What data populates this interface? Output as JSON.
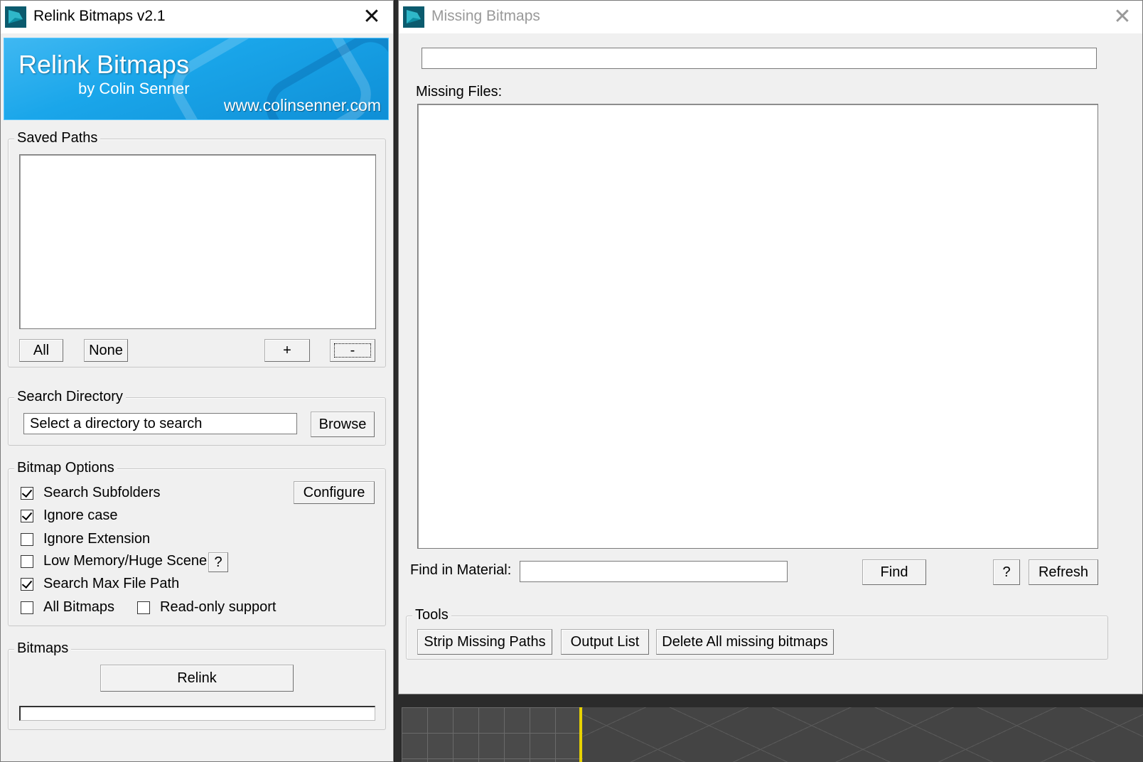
{
  "relink_window": {
    "title": "Relink Bitmaps v2.1",
    "banner": {
      "title": "Relink Bitmaps",
      "author": "by Colin Senner",
      "url": "www.colinsenner.com"
    },
    "saved_paths": {
      "label": "Saved Paths",
      "buttons": {
        "all": "All",
        "none": "None",
        "add": "+",
        "remove": "-"
      }
    },
    "search_directory": {
      "label": "Search Directory",
      "value": "Select a directory to search",
      "browse": "Browse"
    },
    "bitmap_options": {
      "label": "Bitmap Options",
      "configure": "Configure",
      "help": "?",
      "options": [
        {
          "label": "Search Subfolders",
          "checked": true
        },
        {
          "label": "Ignore case",
          "checked": true
        },
        {
          "label": "Ignore Extension",
          "checked": false
        },
        {
          "label": "Low Memory/Huge Scene",
          "checked": false
        },
        {
          "label": "Search Max File Path",
          "checked": true
        },
        {
          "label": "All Bitmaps",
          "checked": false
        },
        {
          "label": "Read-only support",
          "checked": false
        }
      ]
    },
    "bitmaps": {
      "label": "Bitmaps",
      "relink": "Relink",
      "progress": 0
    }
  },
  "missing_window": {
    "title": "Missing Bitmaps",
    "top_field_value": "",
    "missing_files_label": "Missing Files:",
    "find_label": "Find in Material:",
    "find_value": "",
    "find_button": "Find",
    "help_button": "?",
    "refresh_button": "Refresh",
    "tools": {
      "label": "Tools",
      "buttons": [
        "Strip Missing Paths",
        "Output List",
        "Delete All missing bitmaps"
      ]
    }
  },
  "colors": {
    "banner_blue": "#1aa6ea",
    "viewport_highlight": "#e8d200"
  }
}
